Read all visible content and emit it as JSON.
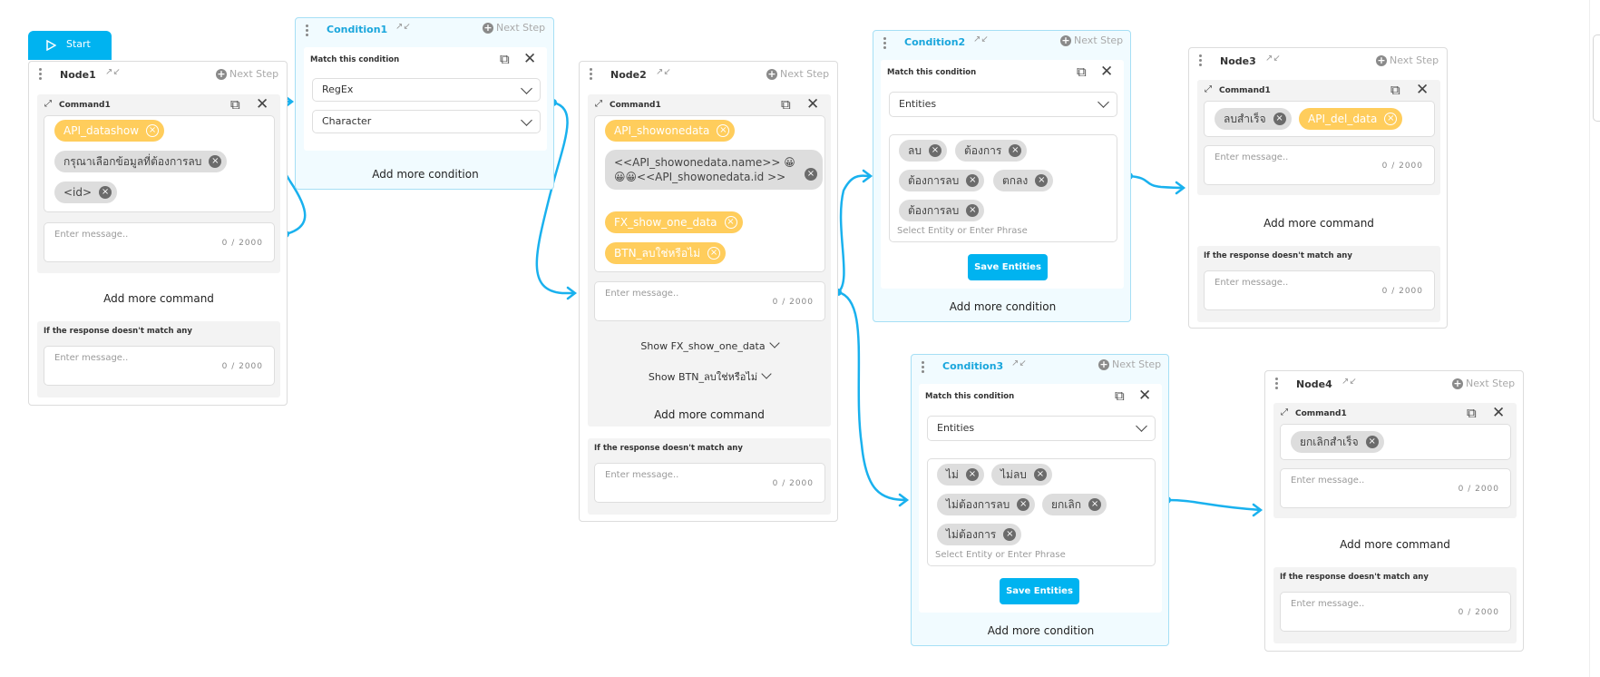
{
  "start": {
    "label": "Start"
  },
  "common": {
    "next_step": "Next Step",
    "enter_message": "Enter message..",
    "counter": "0 / 2000",
    "add_more_command": "Add more command",
    "add_more_condition": "Add more condition",
    "no_match": "If the response doesn't match any",
    "match_condition": "Match this condition",
    "command1": "Command1",
    "select_entity": "Select Entity or Enter Phrase",
    "save_entities": "Save Entities"
  },
  "node1": {
    "title": "Node1",
    "chips": [
      "API_datashow",
      "กรุณาเลือกข้อมูลที่ต้องการลบ",
      "<id>"
    ]
  },
  "condition1": {
    "title": "Condition1",
    "select1": "RegEx",
    "select2": "Character"
  },
  "node2": {
    "title": "Node2",
    "chips": [
      "API_showonedata",
      "<<API_showonedata.name>> 😀😀😀<<API_showonedata.id >>",
      "FX_show_one_data",
      "BTN_ลบใช่หรือไม่"
    ],
    "show1": "Show FX_show_one_data",
    "show2": "Show BTN_ลบใช่หรือไม่"
  },
  "condition2": {
    "title": "Condition2",
    "select": "Entities",
    "entities": [
      "ลบ",
      "ต้องการ",
      "ต้องการลบ",
      "ตกลง",
      "ต้องการลบ"
    ]
  },
  "node3": {
    "title": "Node3",
    "chips": [
      "ลบสำเร็จ",
      "API_del_data"
    ]
  },
  "condition3": {
    "title": "Condition3",
    "select": "Entities",
    "entities": [
      "ไม่",
      "ไม่ลบ",
      "ไม่ต้องการลบ",
      "ยกเลิก",
      "ไม่ต้องการ"
    ]
  },
  "node4": {
    "title": "Node4",
    "chips": [
      "ยกเลิกสำเร็จ"
    ]
  },
  "colors": {
    "accent": "#00b3f0",
    "chip_yellow": "#ffcd5c",
    "chip_gray": "#dddddd"
  }
}
